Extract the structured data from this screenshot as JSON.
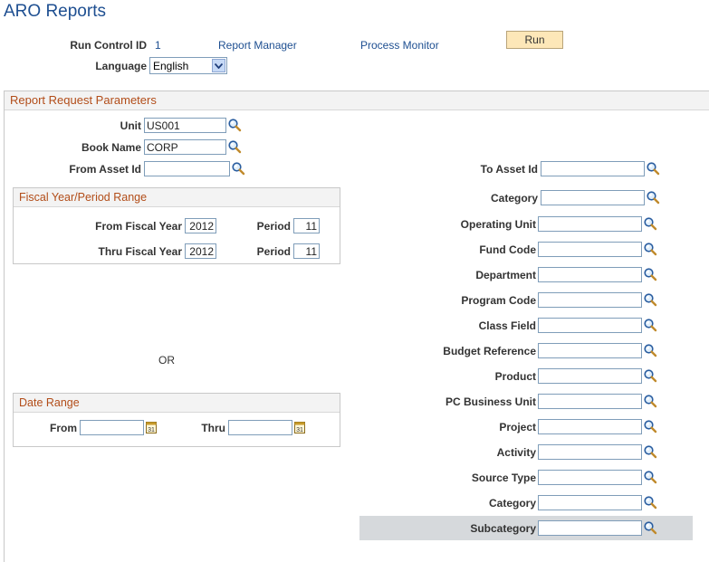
{
  "page": {
    "title": "ARO Reports"
  },
  "header": {
    "run_control_label": "Run Control ID",
    "run_control_value": "1",
    "report_manager": "Report Manager",
    "process_monitor": "Process Monitor",
    "run_button": "Run",
    "language_label": "Language",
    "language_value": "English"
  },
  "params": {
    "section_title": "Report Request Parameters",
    "unit_label": "Unit",
    "unit_value": "US001",
    "book_label": "Book Name",
    "book_value": "CORP",
    "from_asset_label": "From Asset Id",
    "from_asset_value": "",
    "to_asset_label": "To Asset Id",
    "to_asset_value": "",
    "or_text": "OR"
  },
  "fiscal": {
    "title": "Fiscal Year/Period Range",
    "from_year_label": "From Fiscal Year",
    "from_year_value": "2012",
    "from_period_label": "Period",
    "from_period_value": "11",
    "thru_year_label": "Thru Fiscal Year",
    "thru_year_value": "2012",
    "thru_period_label": "Period",
    "thru_period_value": "11"
  },
  "date_range": {
    "title": "Date Range",
    "from_label": "From",
    "from_value": "",
    "thru_label": "Thru",
    "thru_value": ""
  },
  "chartfields": [
    {
      "label": "Category",
      "value": ""
    },
    {
      "label": "Operating Unit",
      "value": ""
    },
    {
      "label": "Fund Code",
      "value": ""
    },
    {
      "label": "Department",
      "value": ""
    },
    {
      "label": "Program Code",
      "value": ""
    },
    {
      "label": "Class Field",
      "value": ""
    },
    {
      "label": "Budget Reference",
      "value": ""
    },
    {
      "label": "Product",
      "value": ""
    },
    {
      "label": "PC Business Unit",
      "value": ""
    },
    {
      "label": "Project",
      "value": ""
    },
    {
      "label": "Activity",
      "value": ""
    },
    {
      "label": "Source Type",
      "value": ""
    },
    {
      "label": "Category",
      "value": ""
    },
    {
      "label": "Subcategory",
      "value": ""
    }
  ],
  "icons": {
    "lookup": "magnifier-icon",
    "calendar": "calendar-icon",
    "dropdown": "chevron-down-icon"
  },
  "colors": {
    "title_blue": "#1e4f91",
    "section_orange": "#b24d19",
    "run_button_bg": "#fde7b8",
    "highlight_row": "#d6d9dc"
  }
}
